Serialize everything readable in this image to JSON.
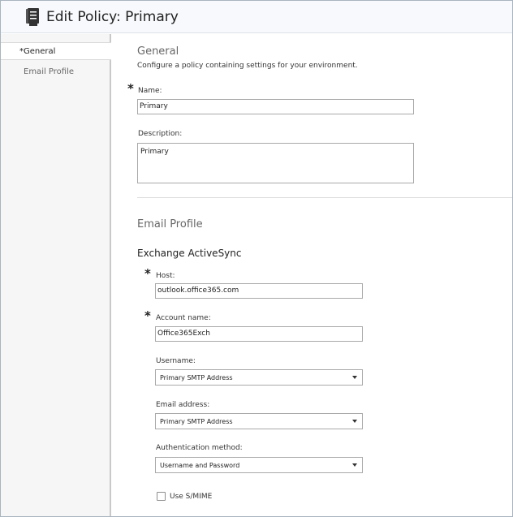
{
  "header": {
    "title": "Edit Policy: Primary",
    "icon": "policy-document-icon"
  },
  "sidebar": {
    "items": [
      {
        "label": "*General",
        "active": true
      },
      {
        "label": "Email Profile",
        "active": false
      }
    ]
  },
  "general": {
    "title": "General",
    "description": "Configure a policy containing settings for your environment.",
    "required_mark": "*",
    "name_label": "Name:",
    "name_value": "Primary",
    "description_label": "Description:",
    "description_value": "Primary"
  },
  "email_profile": {
    "title": "Email Profile",
    "subtitle": "Exchange ActiveSync",
    "required_mark": "*",
    "host_label": "Host:",
    "host_value": "outlook.office365.com",
    "account_label": "Account name:",
    "account_value": "Office365Exch",
    "username_label": "Username:",
    "username_value": "Primary SMTP Address",
    "email_label": "Email address:",
    "email_value": "Primary SMTP Address",
    "auth_label": "Authentication method:",
    "auth_value": "Username and Password",
    "smime_label": "Use S/MIME",
    "smime_checked": false
  },
  "colors": {
    "header_bg": "#f7f9fc",
    "sidebar_bg": "#f6f6f6",
    "divider": "#dcdcdc"
  }
}
